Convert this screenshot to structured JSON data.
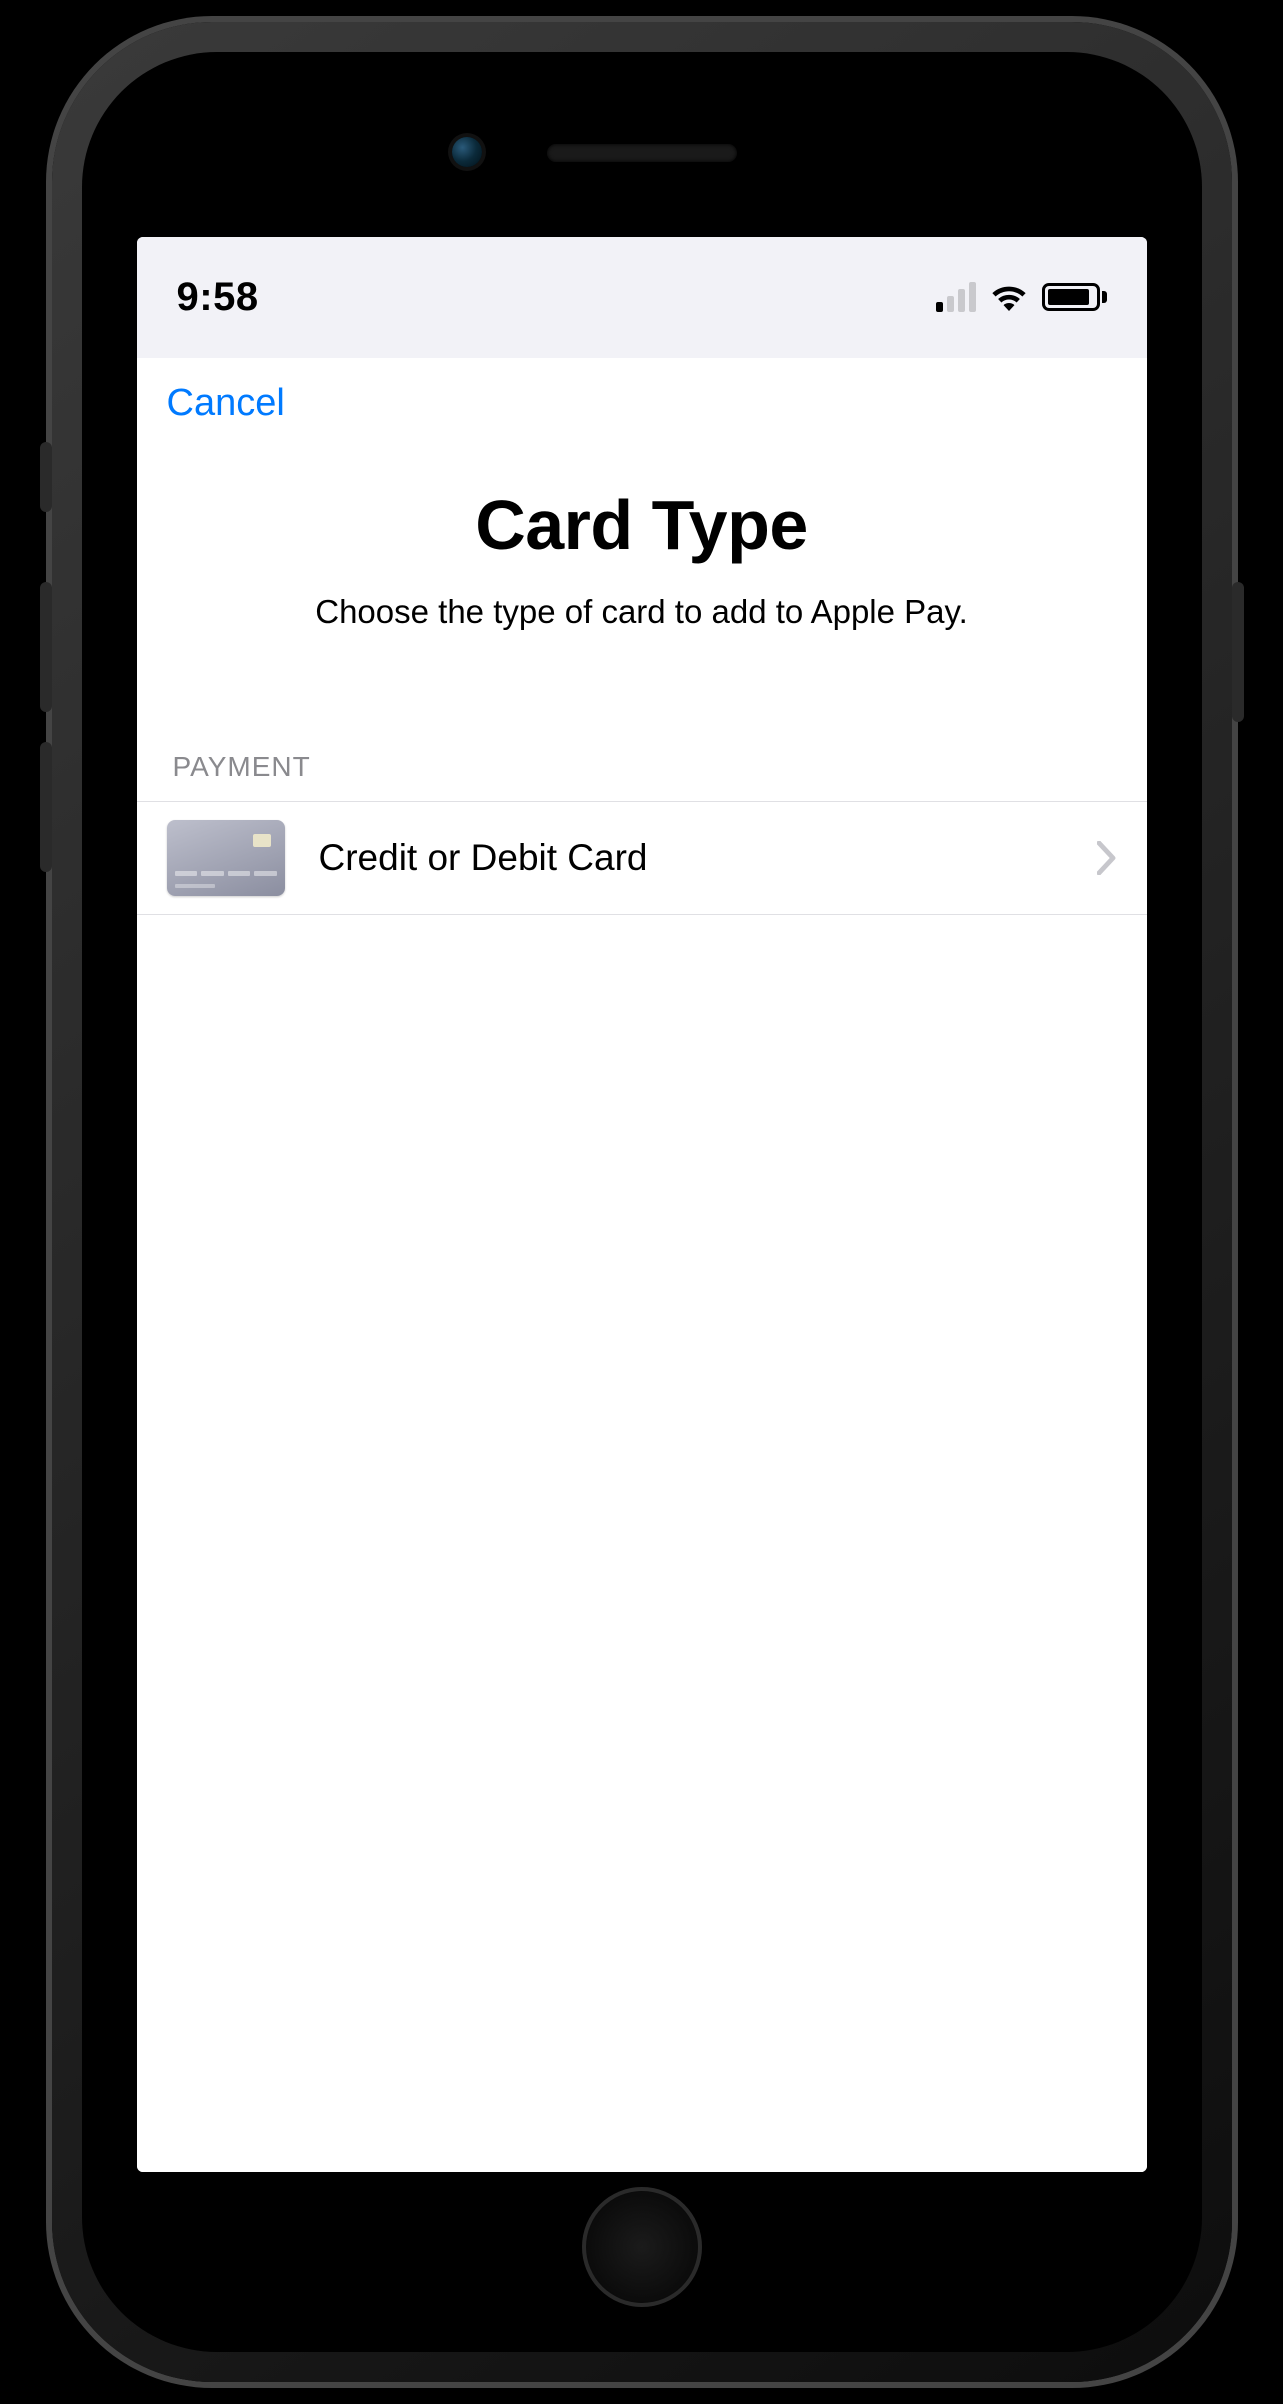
{
  "status": {
    "time": "9:58",
    "signal_bars_filled": 1,
    "signal_bars_total": 4
  },
  "nav": {
    "cancel_label": "Cancel"
  },
  "header": {
    "title": "Card Type",
    "subtitle": "Choose the type of card to add to Apple Pay."
  },
  "sections": [
    {
      "header": "PAYMENT",
      "rows": [
        {
          "icon": "credit-card-icon",
          "label": "Credit or Debit Card"
        }
      ]
    }
  ]
}
